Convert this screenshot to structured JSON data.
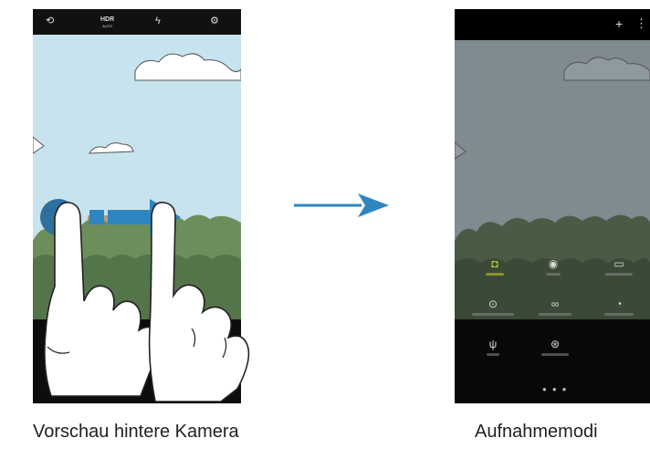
{
  "captions": {
    "left": "Vorschau hintere Kamera",
    "right": "Aufnahmemodi"
  },
  "left_phone": {
    "topbar": {
      "icons": [
        "switch-camera-icon",
        "hdr-icon",
        "flash-off-icon",
        "settings-icon"
      ],
      "hdr_label": "HDR",
      "hdr_sub": "AUTO"
    },
    "gesture": "swipe-right"
  },
  "right_phone": {
    "topbar": {
      "icons": [
        "add-icon",
        "more-icon"
      ]
    },
    "modes": [
      {
        "icon": "camera-mode-icon",
        "active": true
      },
      {
        "icon": "pro-mode-icon",
        "active": false
      },
      {
        "icon": "panorama-icon",
        "active": false
      },
      {
        "icon": "selective-focus-icon",
        "active": false
      },
      {
        "icon": "slow-motion-icon",
        "active": false
      },
      {
        "icon": "hyperlapse-icon",
        "active": false
      },
      {
        "icon": "food-icon",
        "active": false
      },
      {
        "icon": "virtual-shot-icon",
        "active": false
      }
    ],
    "page_dots": 3
  },
  "colors": {
    "sky": "#c7e3ee",
    "accent_blue": "#2e86c1",
    "active_mode": "#c9d12b"
  }
}
